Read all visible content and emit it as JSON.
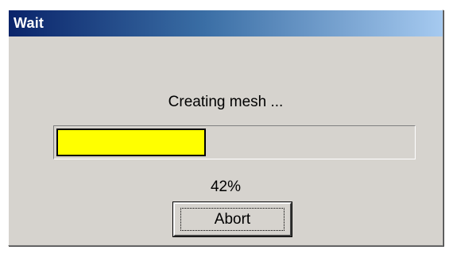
{
  "window": {
    "title": "Wait"
  },
  "dialog": {
    "message": "Creating mesh ...",
    "progress": {
      "value": 0.42,
      "label": "42%"
    },
    "abort_label": "Abort"
  },
  "colors": {
    "title_gradient_start": "#0a246a",
    "title_gradient_end": "#a6caf0",
    "dialog_background": "#d6d3ce",
    "progress_fill": "#ffff00"
  }
}
